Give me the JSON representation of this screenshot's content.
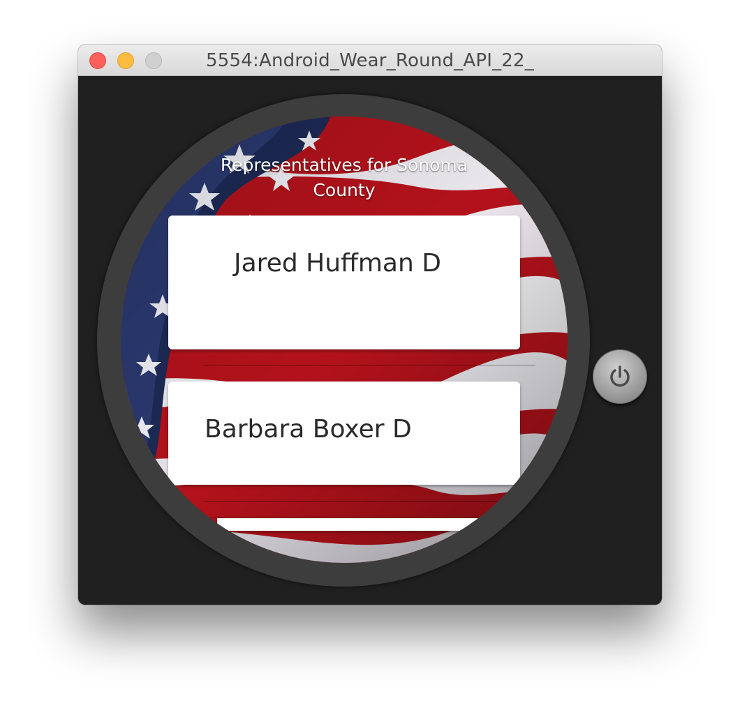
{
  "window": {
    "title": "5554:Android_Wear_Round_API_22_"
  },
  "watch": {
    "header_title": "Representatives for Sonoma County",
    "representatives": [
      {
        "name": "Jared Huffman D"
      },
      {
        "name": "Barbara Boxer D"
      }
    ],
    "power_icon": "power-icon"
  },
  "colors": {
    "close": "#fc605b",
    "minimize": "#fdbc40",
    "zoom": "#d0d0d0",
    "window_bg": "#1f1f1f",
    "bezel": "#3d3d3d",
    "card_bg": "#ffffff"
  }
}
